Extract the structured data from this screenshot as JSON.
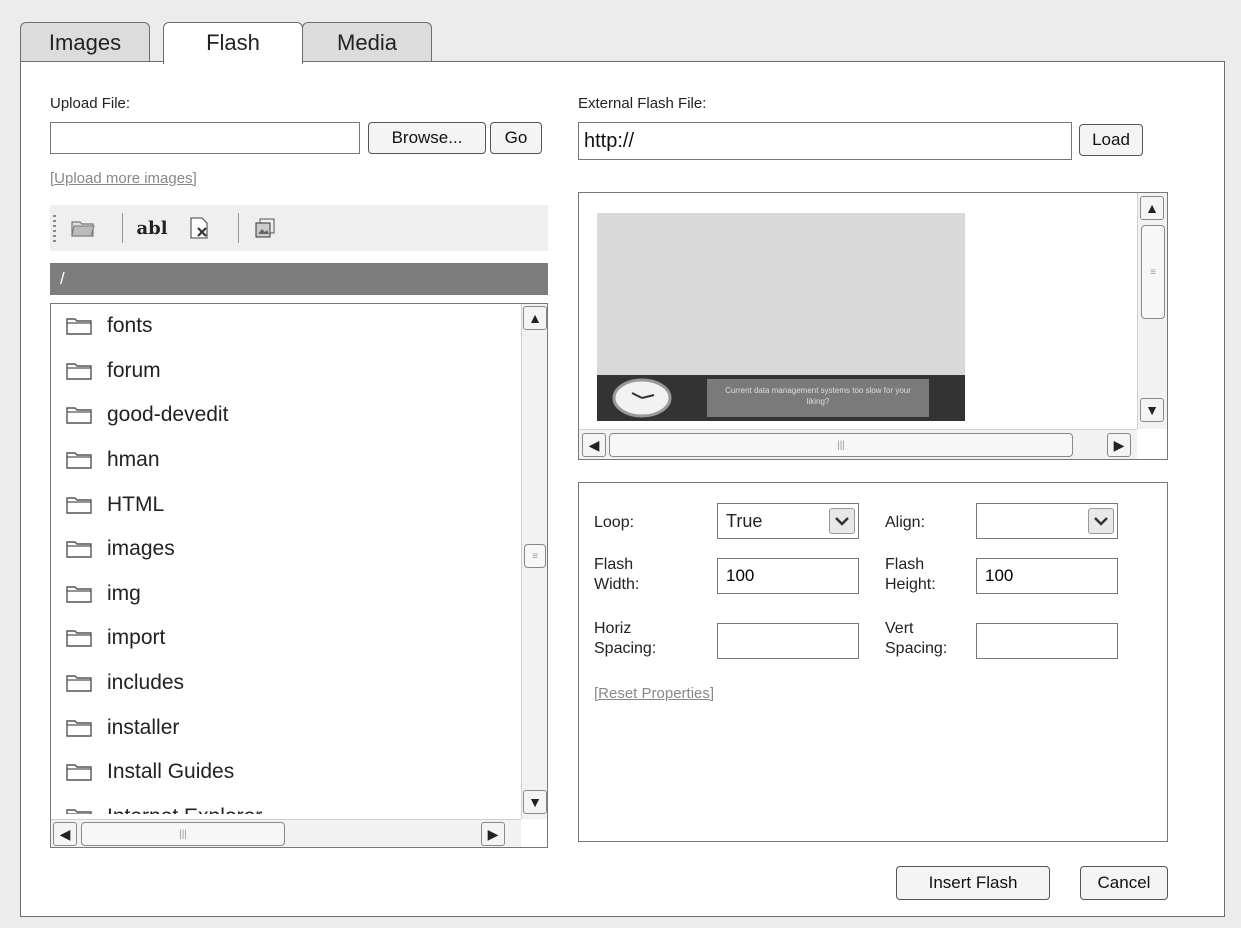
{
  "tabs": [
    {
      "label": "Images",
      "active": false
    },
    {
      "label": "Flash",
      "active": true
    },
    {
      "label": "Media",
      "active": false
    }
  ],
  "upload": {
    "label": "Upload File:",
    "value": "",
    "browse_label": "Browse...",
    "go_label": "Go",
    "more_link": "[Upload more images]"
  },
  "toolbar": {
    "icons": [
      "folder-icon",
      "rename-icon",
      "delete-icon",
      "properties-icon"
    ],
    "rename_text": "abl"
  },
  "path": "/",
  "files": [
    "fonts",
    "forum",
    "good-devedit",
    "hman",
    "HTML",
    "images",
    "img",
    "import",
    "includes",
    "installer",
    "Install Guides",
    "Internet Explorer"
  ],
  "external": {
    "label": "External Flash File:",
    "value": "http://",
    "load_label": "Load"
  },
  "preview": {
    "banner_text": "Current data management systems too slow for your liking?"
  },
  "properties": {
    "loop_label": "Loop:",
    "loop_value": "True",
    "align_label": "Align:",
    "align_value": "",
    "flash_width_label_1": "Flash",
    "flash_width_label_2": "Width:",
    "flash_width_value": "100",
    "flash_height_label_1": "Flash",
    "flash_height_label_2": "Height:",
    "flash_height_value": "100",
    "horiz_label_1": "Horiz",
    "horiz_label_2": "Spacing:",
    "horiz_value": "",
    "vert_label_1": "Vert",
    "vert_label_2": "Spacing:",
    "vert_value": "",
    "reset_link": "[Reset Properties]"
  },
  "actions": {
    "insert_label": "Insert Flash",
    "cancel_label": "Cancel"
  }
}
